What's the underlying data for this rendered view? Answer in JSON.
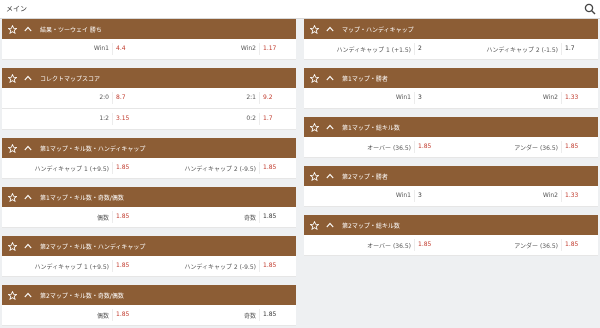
{
  "topbar": {
    "title": "メイン",
    "search_icon": "search-icon"
  },
  "colors": {
    "header_bg": "#8c5d35",
    "odds_red": "#c0392b"
  },
  "left_markets": [
    {
      "title": "結果・ツーウェイ 勝ち",
      "rows": [
        [
          {
            "label": "Win1",
            "odds": "4.4",
            "red": true
          },
          {
            "label": "Win2",
            "odds": "1.17",
            "red": true
          }
        ]
      ]
    },
    {
      "title": "コレクトマップスコア",
      "rows": [
        [
          {
            "label": "2:0",
            "odds": "8.7",
            "red": true
          },
          {
            "label": "2:1",
            "odds": "9.2",
            "red": true
          }
        ],
        [
          {
            "label": "1:2",
            "odds": "3.15",
            "red": true
          },
          {
            "label": "0:2",
            "odds": "1.7",
            "red": true
          }
        ]
      ]
    },
    {
      "title": "第1マップ・キル数・ハンディキャップ",
      "rows": [
        [
          {
            "label": "ハンディキャップ 1 (+9.5)",
            "odds": "1.85",
            "red": true
          },
          {
            "label": "ハンディキャップ 2 (-9.5)",
            "odds": "1.85",
            "red": true
          }
        ]
      ]
    },
    {
      "title": "第1マップ・キル数・奇数/偶数",
      "rows": [
        [
          {
            "label": "偶数",
            "odds": "1.85",
            "red": true
          },
          {
            "label": "奇数",
            "odds": "1.85",
            "red": false
          }
        ]
      ]
    },
    {
      "title": "第2マップ・キル数・ハンディキャップ",
      "rows": [
        [
          {
            "label": "ハンディキャップ 1 (+9.5)",
            "odds": "1.85",
            "red": true
          },
          {
            "label": "ハンディキャップ 2 (-9.5)",
            "odds": "1.85",
            "red": true
          }
        ]
      ]
    },
    {
      "title": "第2マップ・キル数・奇数/偶数",
      "rows": [
        [
          {
            "label": "偶数",
            "odds": "1.85",
            "red": true
          },
          {
            "label": "奇数",
            "odds": "1.85",
            "red": false
          }
        ]
      ]
    }
  ],
  "right_markets": [
    {
      "title": "マップ・ハンディキャップ",
      "rows": [
        [
          {
            "label": "ハンディキャップ 1 (+1.5)",
            "odds": "2",
            "red": false
          },
          {
            "label": "ハンディキャップ 2 (-1.5)",
            "odds": "1.7",
            "red": false
          }
        ]
      ]
    },
    {
      "title": "第1マップ・勝者",
      "rows": [
        [
          {
            "label": "Win1",
            "odds": "3",
            "red": false
          },
          {
            "label": "Win2",
            "odds": "1.33",
            "red": true
          }
        ]
      ]
    },
    {
      "title": "第1マップ・総キル数",
      "rows": [
        [
          {
            "label": "オーバー (36.5)",
            "odds": "1.85",
            "red": true
          },
          {
            "label": "アンダー (36.5)",
            "odds": "1.85",
            "red": true
          }
        ]
      ]
    },
    {
      "title": "第2マップ・勝者",
      "rows": [
        [
          {
            "label": "Win1",
            "odds": "3",
            "red": false
          },
          {
            "label": "Win2",
            "odds": "1.33",
            "red": true
          }
        ]
      ]
    },
    {
      "title": "第2マップ・総キル数",
      "rows": [
        [
          {
            "label": "オーバー (36.5)",
            "odds": "1.85",
            "red": true
          },
          {
            "label": "アンダー (36.5)",
            "odds": "1.85",
            "red": true
          }
        ]
      ]
    }
  ]
}
